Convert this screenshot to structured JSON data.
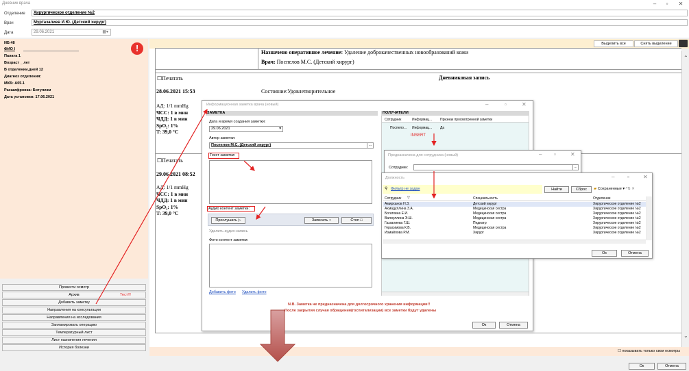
{
  "window": {
    "title": "Дневник врача"
  },
  "header": {
    "department_label": "Отделение",
    "department": "Хирургическое отделение №2",
    "doctor_label": "Врач",
    "doctor": "Муртазалиев И.Ю. (Детский хирург)",
    "date_label": "Дата",
    "date": "29.06.2021"
  },
  "patient": {
    "ib": "ИБ 48",
    "fio": "ФИО I",
    "ward": "Палата 1",
    "age": "Возраст _ лет",
    "days": "В отделении,дней 12",
    "diag_label": "Диагноз отделения:",
    "mkb": "МКБ: A05.1",
    "decoding": "Расшифровка: Ботулизм",
    "set_date": "Дата установки: 17.06.2021"
  },
  "alert": {
    "symbol": "!"
  },
  "nav": {
    "items": [
      "Провести осмотр",
      "Архив",
      "Добавить заметку",
      "Направления на консультации",
      "Направления на исследования",
      "Запланировать операцию",
      "Температурный лист",
      "Лист назначения лечения",
      "История болезни"
    ],
    "archive_badge": "Тест!!!"
  },
  "toolbar": {
    "select_all": "Выделить все",
    "deselect": "Снять выделение"
  },
  "record": {
    "planned_label": "Назначено оперативное лечение:",
    "planned_value": "Удаление доброкачественных новообразований кожи",
    "doctor_label": "Врач:",
    "doctor_value": "Поспелов М.С. (Детский хирург)"
  },
  "entries": [
    {
      "print": "Печатать",
      "title": "Дневниковая запись",
      "datetime": "28.06.2021 15:53",
      "state": "Состояние:Удовлетворительное",
      "vitals": [
        "АД: 1/1 mmHg",
        "ЧСС: 1 в мин",
        "ЧДД: 1 в мин",
        "SpO₂: 1%",
        "T: 39,0 °C"
      ]
    },
    {
      "print": "Печатать",
      "datetime": "29.06.2021 08:52",
      "vitals": [
        "АД: 1/1 mmHg",
        "ЧСС: 1 в мин",
        "ЧДД: 1 в мин",
        "SpO₂: 1%",
        "T: 39,0 °C"
      ]
    }
  ],
  "note_dialog": {
    "title": "Информационная заметка врача (новый)",
    "section": "ЗАМЕТКА",
    "created_label": "Дата и время создания заметки:",
    "created_value": "29.06.2021",
    "author_label": "Автор заметки:",
    "author_value": "Поспелов М.С. (Детский хирург)",
    "text_label": "Текст заметки:",
    "audio_label": "Аудио контент заметки:",
    "play_btn": "Прослушать",
    "record_btn": "Записать",
    "stop_btn": "Стоп",
    "delete_audio": "Удалить аудио-запись",
    "photo_label": "Фото контент заметки:",
    "add_photo": "Добавить фото",
    "delete_photo": "Удалить фото",
    "recipients_section": "ПОЛУЧАТЕЛИ",
    "recipients_cols": [
      "Сотрудник",
      "Информац...",
      "Признак просмотренной заметки"
    ],
    "recipients_row": [
      "Поспело...",
      "Информац...",
      "Да"
    ],
    "insert": "INSERT",
    "notice1": "N.B. Заметка не предназначена для долгосрочного хранения информации!!",
    "notice2": "После закрытия случая обращения(госпитализации) все заметки будут удалены",
    "ok": "Ок",
    "cancel": "Отмена"
  },
  "assign_dialog": {
    "title": "Предназначена для сотрудника (новый)",
    "employee_label": "Сотрудник:"
  },
  "position_dialog": {
    "title": "Должность",
    "filter": "Фильтр не задан",
    "find": "Найти",
    "reset": "Сброс",
    "saved": "Сохраненные",
    "columns": [
      "Сотрудник",
      "Специальность",
      "Отделение"
    ],
    "rows": [
      [
        "Амирханов Н.З.",
        "Детский хирург",
        "Хирургическое отделение №2"
      ],
      [
        "Ахмадуллина З.А.",
        "Медицинская сестра",
        "Хирургическое отделение №2"
      ],
      [
        "Богаткина Е.И.",
        "Медицинская сестра",
        "Хирургическое отделение №2"
      ],
      [
        "Валиуллина Э.Ш.",
        "Медицинская сестра",
        "Хирургическое отделение №2"
      ],
      [
        "Газзалиева Г.Ш.",
        "Педиатр",
        "Хирургическое отделение №2"
      ],
      [
        "Герасимова К.В.",
        "Медицинская сестра",
        "Хирургическое отделение №2"
      ],
      [
        "Измайлова Р.М.",
        "Хирург",
        "Хирургическое отделение №2"
      ]
    ],
    "ok": "Ок",
    "cancel": "Отмена"
  },
  "footer": {
    "only_own": "показывать только свои осмотры",
    "ok": "Ок",
    "cancel": "Отмена"
  },
  "colors": {
    "panel": "#fde9d9",
    "alert": "#e8322d",
    "annotation": "#e32222",
    "arrow": "#c0504d"
  }
}
